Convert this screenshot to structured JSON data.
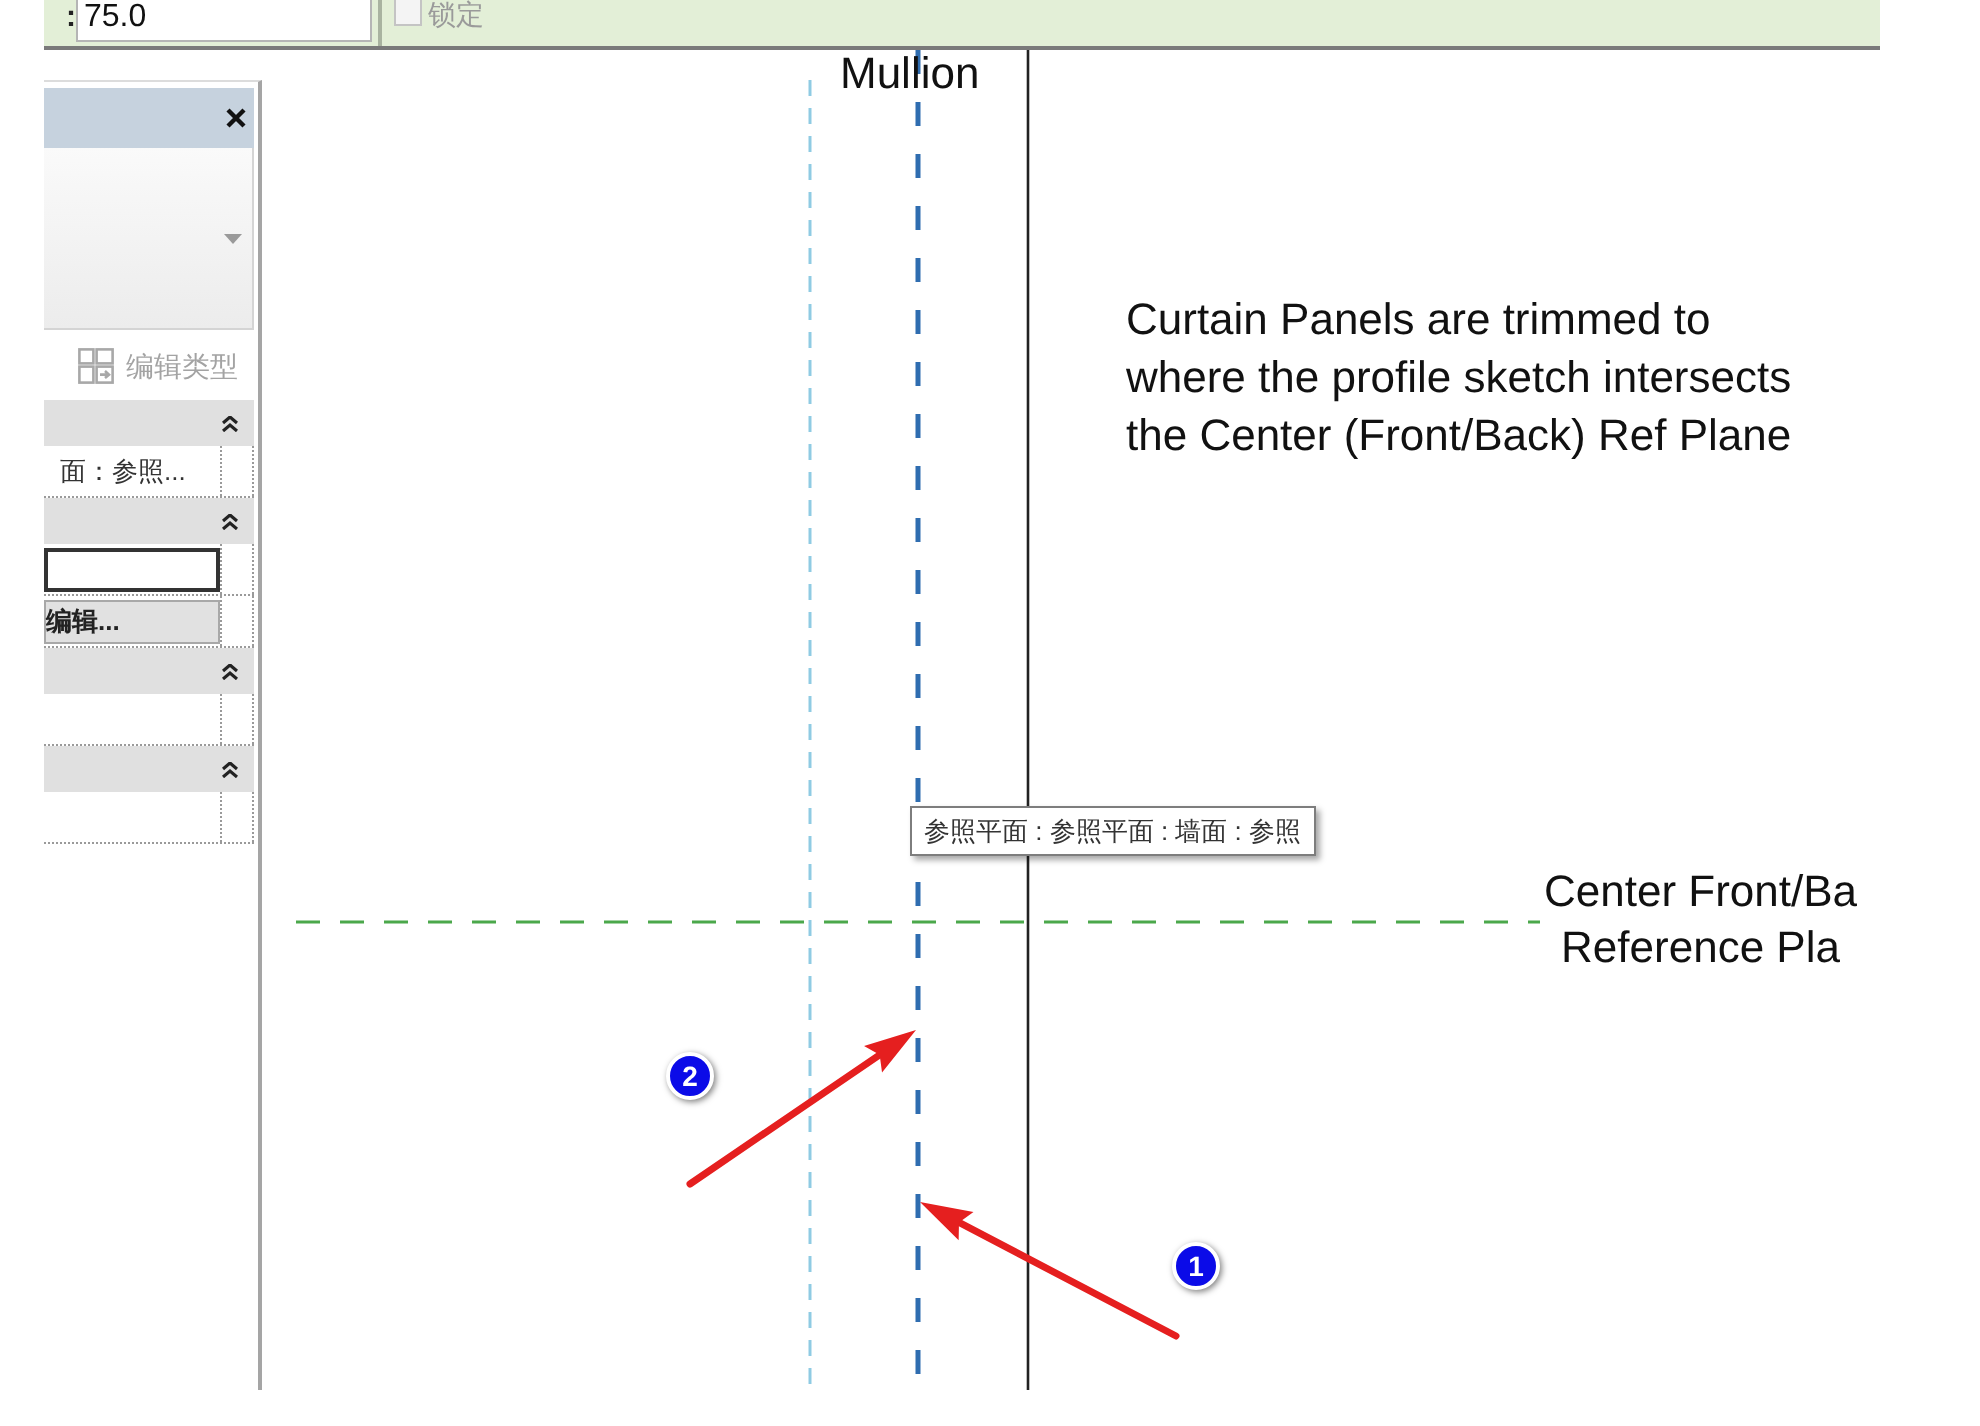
{
  "options_bar": {
    "offset_label": ":",
    "offset_value": "75.0",
    "lock": {
      "label": "锁定",
      "checked": false,
      "disabled": true
    }
  },
  "properties_panel": {
    "edit_type": {
      "label": "编辑类型",
      "disabled": true
    },
    "sections": [
      {
        "expanded": true,
        "rows": [
          {
            "kind": "text",
            "value": "面：参照..."
          }
        ]
      },
      {
        "expanded": true,
        "rows": [
          {
            "kind": "input"
          },
          {
            "kind": "button",
            "label": "编辑..."
          }
        ]
      },
      {
        "expanded": true,
        "rows": [
          {
            "kind": "empty"
          }
        ]
      },
      {
        "expanded": true,
        "rows": [
          {
            "kind": "empty"
          }
        ]
      }
    ]
  },
  "canvas": {
    "mullion_label": "Mullion",
    "note": [
      "Curtain Panels are trimmed to",
      "where the profile sketch intersects",
      "the Center (Front/Back) Ref Plane"
    ],
    "plane_label": [
      "Center Front/Ba",
      "Reference Pla"
    ],
    "tooltip": "参照平面 : 参照平面 : 墙面 : 参照",
    "callouts": [
      "2",
      "1"
    ]
  }
}
